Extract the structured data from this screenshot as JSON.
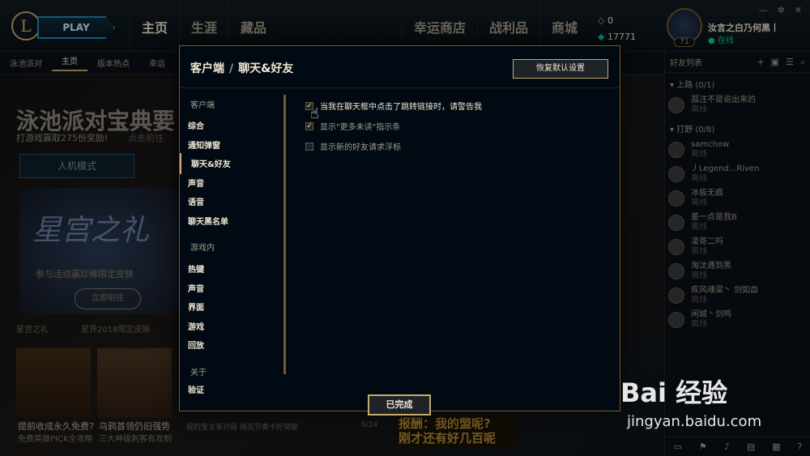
{
  "topbar": {
    "play": "PLAY",
    "nav": [
      "主页",
      "生涯",
      "藏品",
      "幸运商店",
      "战利品",
      "商城"
    ],
    "currency_rp": "0",
    "currency_be": "17771",
    "summoner_name": "汝言之白乃何黑丨",
    "status": "在线",
    "level": "71"
  },
  "subnav": [
    "泳池派对",
    "主页",
    "版本热点",
    "幸运"
  ],
  "background": {
    "title": "泳池派对宝典要",
    "subtitle": "打游戏赢取275份奖励!",
    "subtitle_link": "点击前往",
    "mode_button": "人机模式",
    "banner_title": "星宫之礼",
    "banner_sub": "参与活动赢珍稀限定皮肤",
    "banner_go": "立即前往",
    "tabs": [
      "星宫之礼",
      "星界2018限定皮肤"
    ],
    "card1_title": "提前收成永久免费?",
    "card1_sub": "免费英雄PICK全攻略",
    "card2_title": "乌鸦首领仍旧强势",
    "card2_sub": "三大神级刺客有攻制",
    "message": "我的宝主来对局 炮击节奏卡好突破",
    "message_count": "0/24",
    "promo_line1": "报酬：我的盟呢?",
    "promo_line2": "刚才还有好几百呢"
  },
  "friends": {
    "title": "好友列表",
    "groups": [
      {
        "name": "上路 (0/1)",
        "members": [
          {
            "name": "孤注不是说出来的",
            "status": "离线"
          }
        ]
      },
      {
        "name": "打野 (0/8)",
        "members": [
          {
            "name": "samchow",
            "status": "离线"
          },
          {
            "name": "丿Legend...Riven",
            "status": "离线"
          },
          {
            "name": "冰极无痕",
            "status": "离线"
          },
          {
            "name": "差一点是我B",
            "status": "离线"
          },
          {
            "name": "凌哥二吗",
            "status": "离线"
          },
          {
            "name": "淘汰遇到黑",
            "status": "离线"
          },
          {
            "name": "疾风魂梁丶 剑如血",
            "status": "离线"
          },
          {
            "name": "闲城丶剑鸣",
            "status": "离线"
          }
        ]
      }
    ]
  },
  "modal": {
    "breadcrumb_root": "客户端",
    "breadcrumb_sep": "/",
    "breadcrumb_current": "聊天&好友",
    "reset_button": "恢复默认设置",
    "done_button": "已完成",
    "side_groups": [
      {
        "header": "客户端",
        "items": [
          "综合",
          "通知弹窗",
          "聊天&好友",
          "声音",
          "语音",
          "聊天黑名单"
        ]
      },
      {
        "header": "游戏内",
        "items": [
          "热键",
          "声音",
          "界面",
          "游戏",
          "回放"
        ]
      },
      {
        "header": "关于",
        "items": [
          "验证"
        ]
      }
    ],
    "options": [
      {
        "label": "当我在聊天框中点击了跳转链接时，请警告我",
        "checked": true
      },
      {
        "label": "显示\"更多未读\"指示条",
        "checked": true
      },
      {
        "label": "显示新的好友请求浮标",
        "checked": false
      }
    ]
  },
  "watermark": {
    "logo": "Bai 经验",
    "url": "jingyan.baidu.com"
  }
}
